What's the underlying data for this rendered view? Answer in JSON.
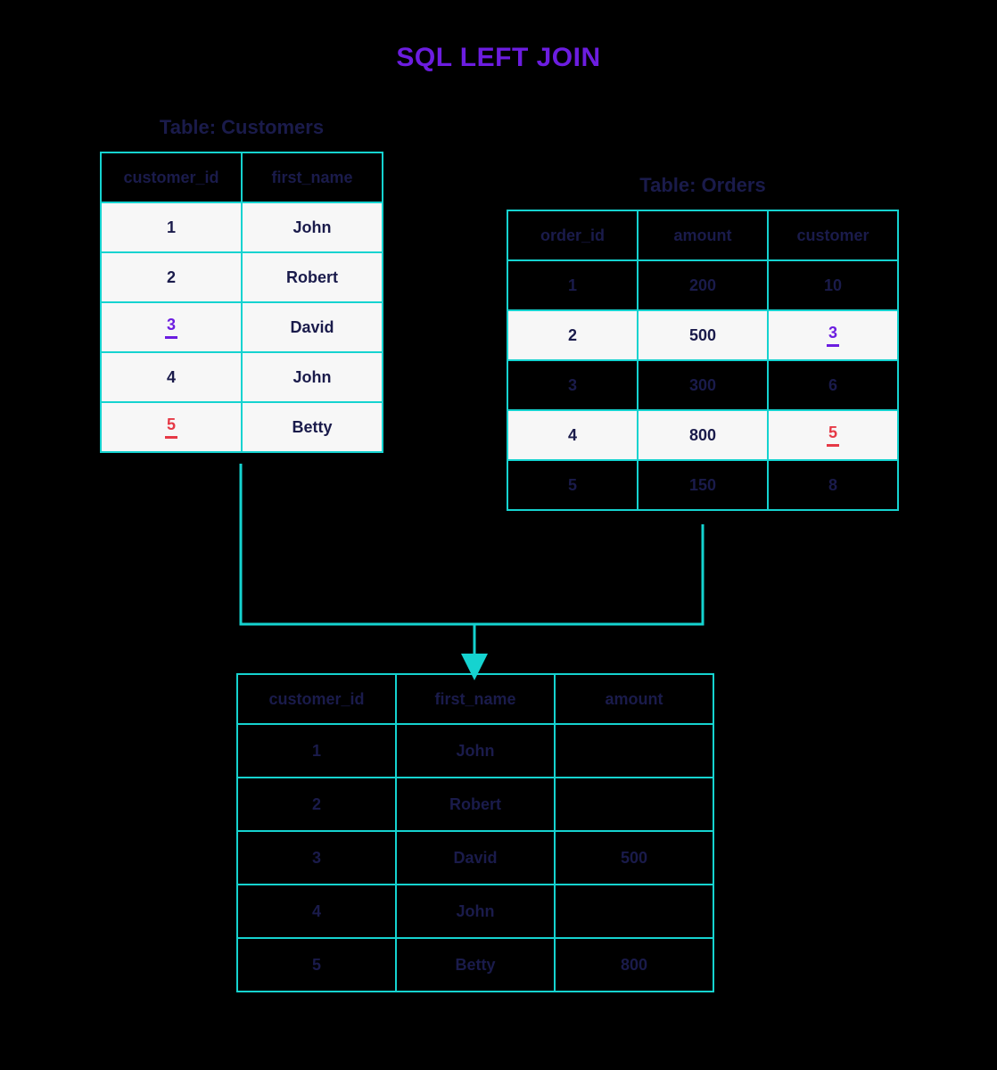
{
  "title": "SQL LEFT JOIN",
  "customers": {
    "label": "Table: Customers",
    "headers": [
      "customer_id",
      "first_name"
    ],
    "rows": [
      {
        "id": "1",
        "name": "John",
        "highlight": true,
        "id_mark": null
      },
      {
        "id": "2",
        "name": "Robert",
        "highlight": true,
        "id_mark": null
      },
      {
        "id": "3",
        "name": "David",
        "highlight": true,
        "id_mark": "purple"
      },
      {
        "id": "4",
        "name": "John",
        "highlight": true,
        "id_mark": null
      },
      {
        "id": "5",
        "name": "Betty",
        "highlight": true,
        "id_mark": "red"
      }
    ]
  },
  "orders": {
    "label": "Table: Orders",
    "headers": [
      "order_id",
      "amount",
      "customer"
    ],
    "rows": [
      {
        "order_id": "1",
        "amount": "200",
        "customer": "10",
        "highlight": false,
        "cust_mark": null
      },
      {
        "order_id": "2",
        "amount": "500",
        "customer": "3",
        "highlight": true,
        "cust_mark": "purple"
      },
      {
        "order_id": "3",
        "amount": "300",
        "customer": "6",
        "highlight": false,
        "cust_mark": null
      },
      {
        "order_id": "4",
        "amount": "800",
        "customer": "5",
        "highlight": true,
        "cust_mark": "red"
      },
      {
        "order_id": "5",
        "amount": "150",
        "customer": "8",
        "highlight": false,
        "cust_mark": null
      }
    ]
  },
  "result": {
    "headers": [
      "customer_id",
      "first_name",
      "amount"
    ],
    "rows": [
      {
        "customer_id": "1",
        "first_name": "John",
        "amount": ""
      },
      {
        "customer_id": "2",
        "first_name": "Robert",
        "amount": ""
      },
      {
        "customer_id": "3",
        "first_name": "David",
        "amount": "500"
      },
      {
        "customer_id": "4",
        "first_name": "John",
        "amount": ""
      },
      {
        "customer_id": "5",
        "first_name": "Betty",
        "amount": "800"
      }
    ]
  }
}
